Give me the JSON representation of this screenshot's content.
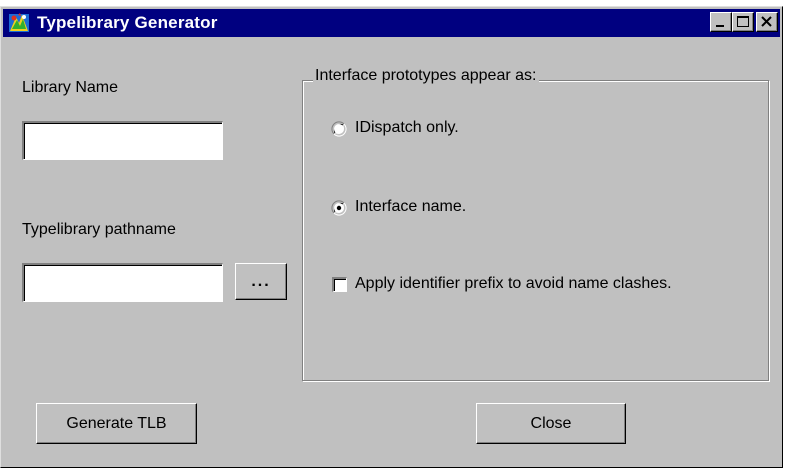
{
  "window": {
    "title": "Typelibrary Generator",
    "icon": "typelib-app-icon",
    "title_bar_color": "#000080",
    "face_color": "#c0c0c0"
  },
  "form": {
    "library_name_label": "Library Name",
    "library_name_value": "",
    "pathname_label": "Typelibrary pathname",
    "pathname_value": "",
    "browse_label": "..."
  },
  "prototypes": {
    "group_title": "Interface prototypes appear as:",
    "options": [
      {
        "label": "IDispatch only.",
        "selected": false
      },
      {
        "label": "Interface name.",
        "selected": true
      }
    ],
    "prefix_checkbox": {
      "label": "Apply identifier prefix to avoid name clashes.",
      "checked": false
    }
  },
  "buttons": {
    "generate": "Generate TLB",
    "close": "Close"
  }
}
